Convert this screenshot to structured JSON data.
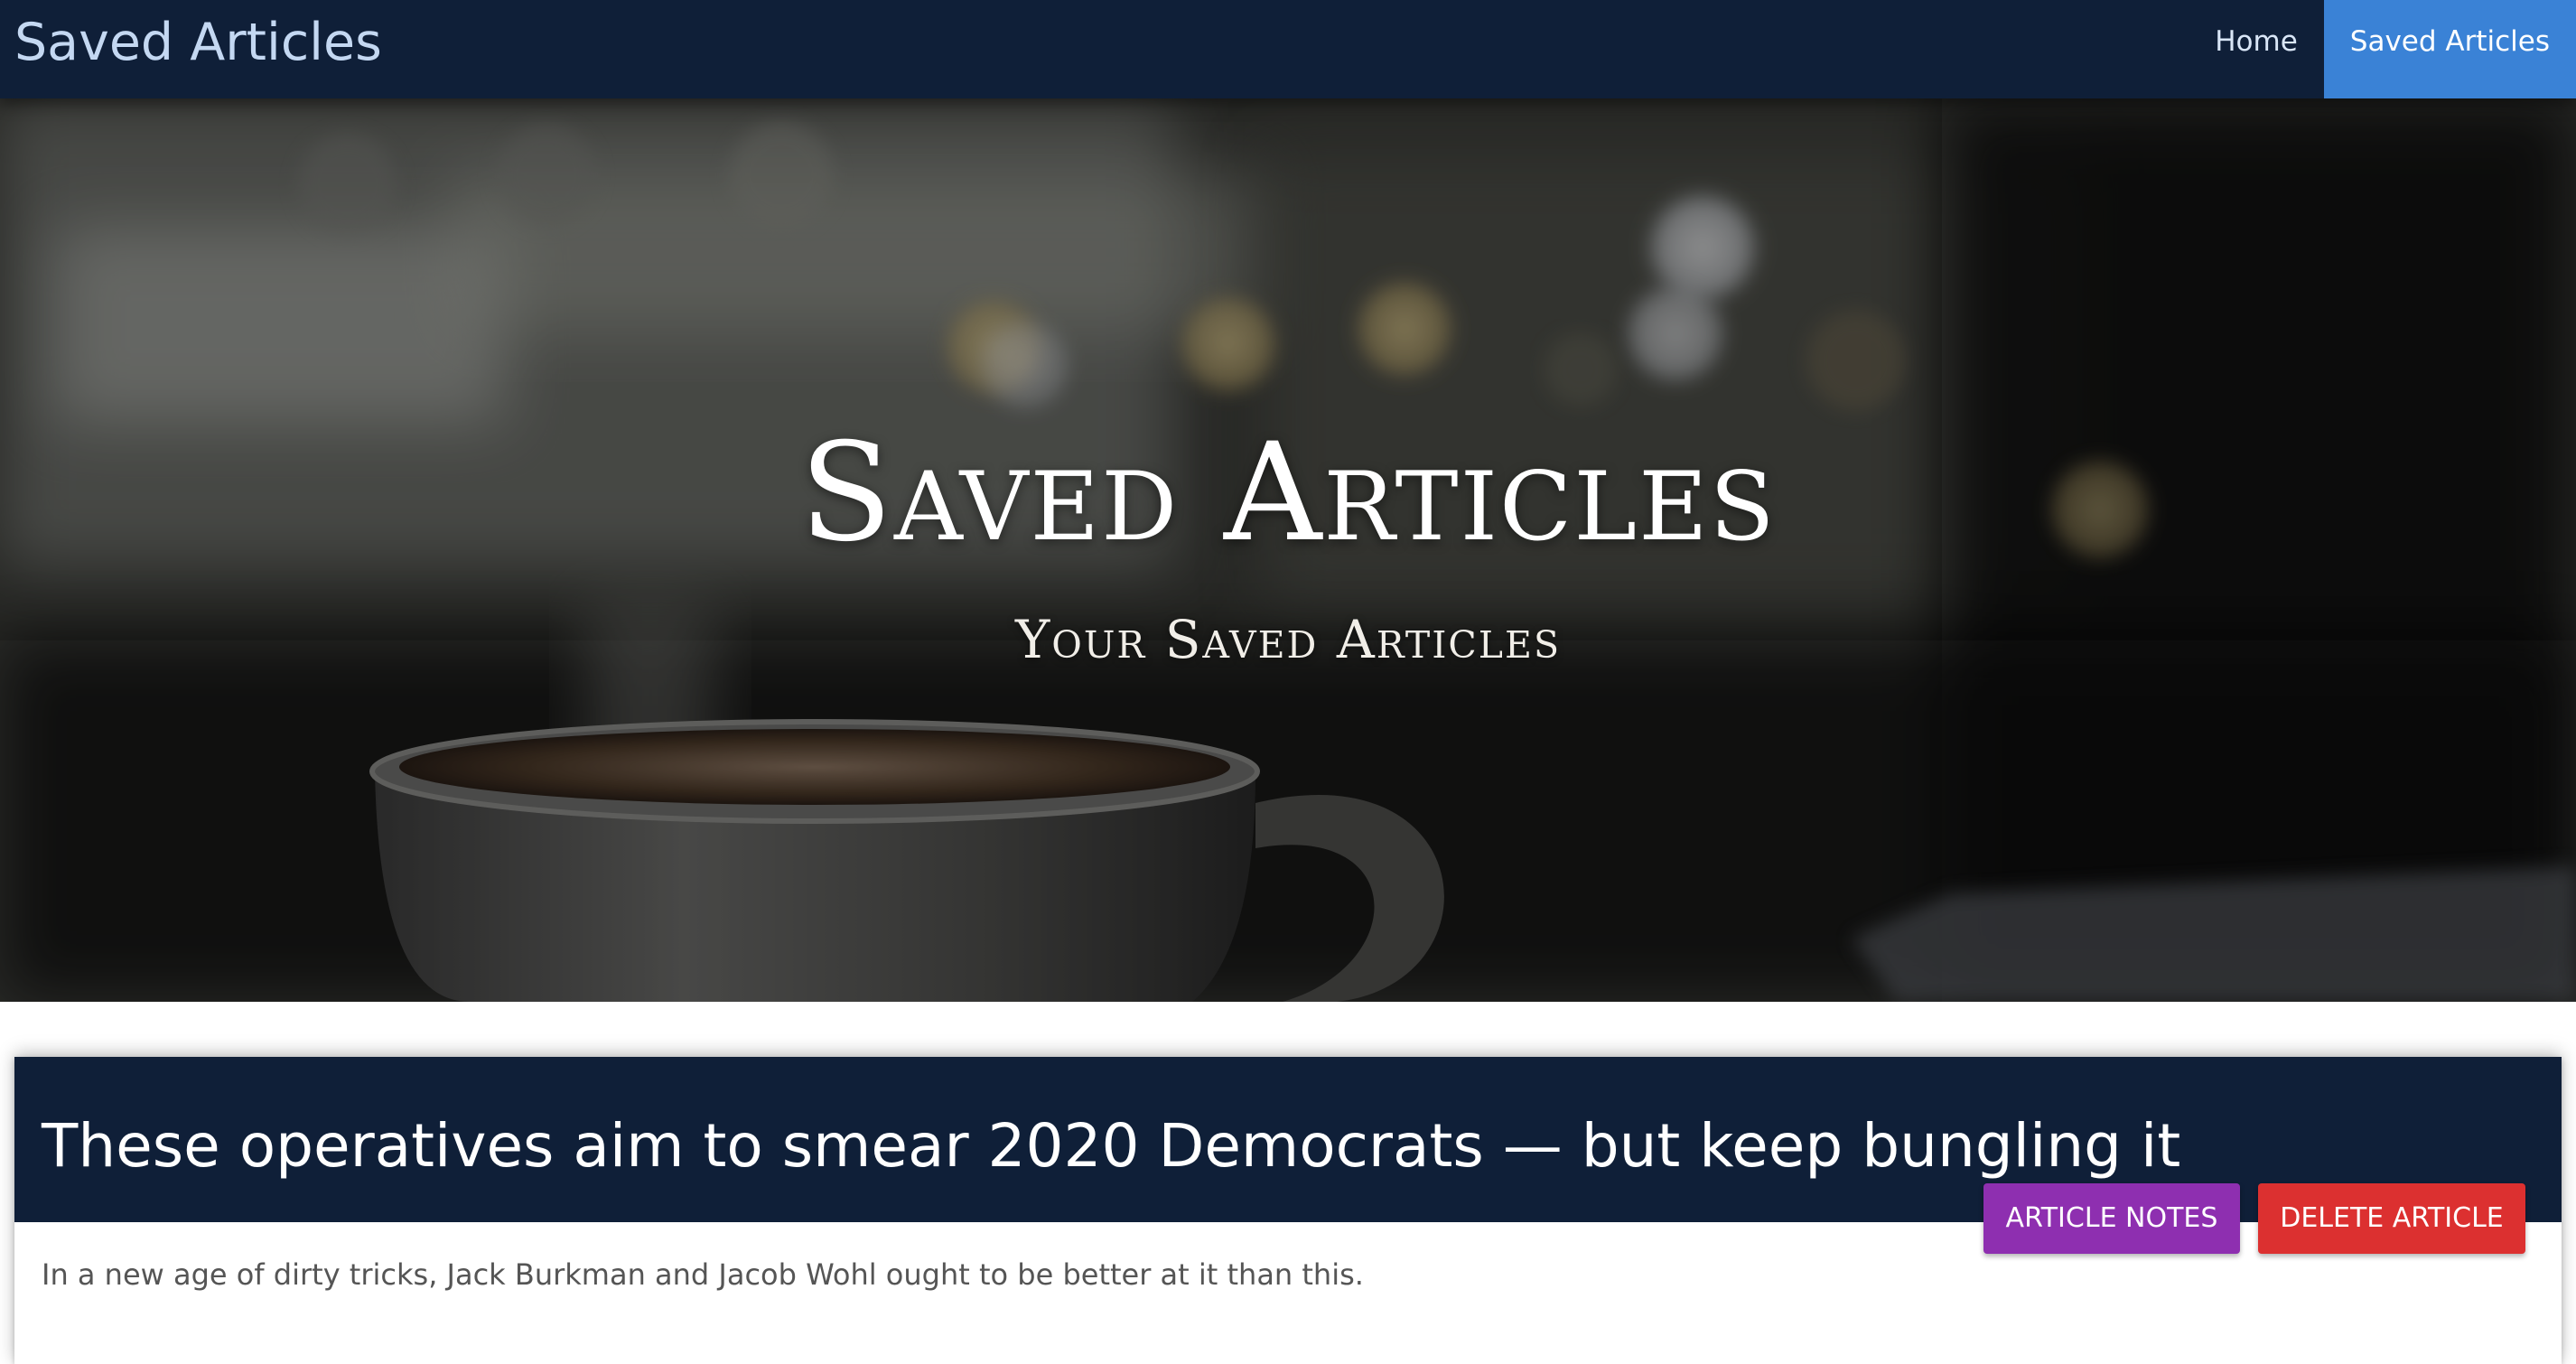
{
  "navbar": {
    "brand": "Saved Articles",
    "links": [
      {
        "label": "Home",
        "active": false
      },
      {
        "label": "Saved Articles",
        "active": true
      }
    ]
  },
  "hero": {
    "title": "Saved Articles",
    "subtitle": "Your Saved Articles"
  },
  "articles": [
    {
      "title": "These operatives aim to smear 2020 Democrats — but keep bungling it",
      "summary": "In a new age of dirty tricks, Jack Burkman and Jacob Wohl ought to be better at it than this.",
      "notes_label": "ARTICLE NOTES",
      "delete_label": "DELETE ARTICLE"
    }
  ],
  "colors": {
    "navbar_bg": "#0f1f38",
    "nav_active": "#3a82d6",
    "notes_button": "#8e2fb0",
    "delete_button": "#dc3030"
  }
}
